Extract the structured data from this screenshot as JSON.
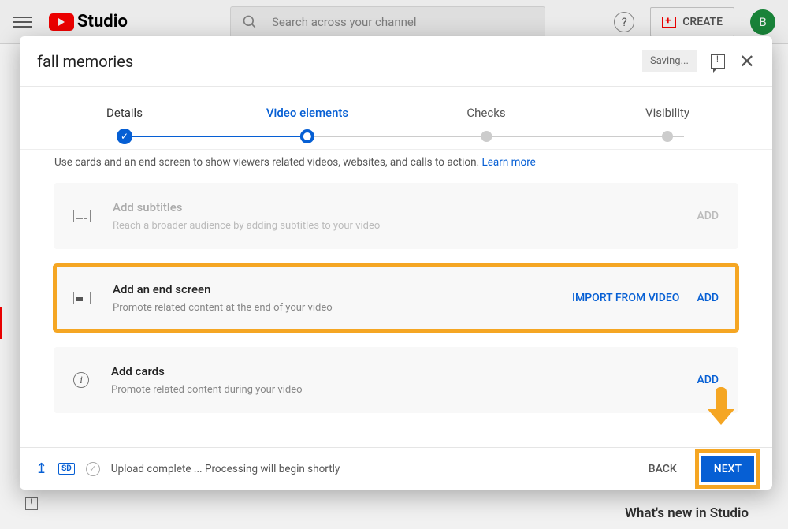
{
  "topbar": {
    "logo_text": "Studio",
    "search_placeholder": "Search across your channel",
    "create_label": "CREATE",
    "avatar_letter": "B"
  },
  "dialog": {
    "title": "fall memories",
    "saving_label": "Saving..."
  },
  "stepper": {
    "s1": "Details",
    "s2": "Video elements",
    "s3": "Checks",
    "s4": "Visibility"
  },
  "content": {
    "intro": "Use cards and an end screen to show viewers related videos, websites, and calls to action. ",
    "learn_more": "Learn more",
    "cards": {
      "subtitles": {
        "title": "Add subtitles",
        "sub": "Reach a broader audience by adding subtitles to your video",
        "add": "ADD"
      },
      "endscreen": {
        "title": "Add an end screen",
        "sub": "Promote related content at the end of your video",
        "import": "IMPORT FROM VIDEO",
        "add": "ADD"
      },
      "addcards": {
        "title": "Add cards",
        "sub": "Promote related content during your video",
        "add": "ADD"
      }
    }
  },
  "footer": {
    "sd": "SD",
    "status": "Upload complete ... Processing will begin shortly",
    "back": "BACK",
    "next": "NEXT"
  },
  "bg_bottom": "What's new in Studio"
}
